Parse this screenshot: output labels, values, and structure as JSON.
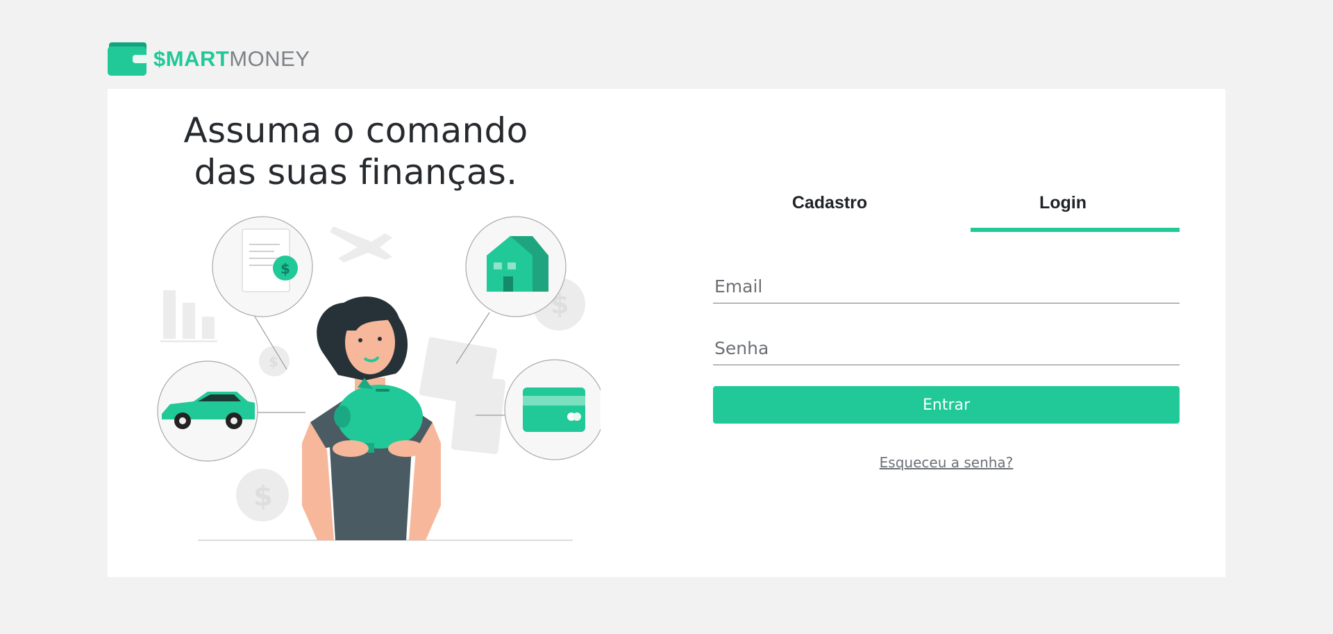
{
  "brand": {
    "name_bold": "$MART",
    "name_light": "MONEY",
    "accent_color": "#20c997",
    "icon": "wallet-icon"
  },
  "hero": {
    "headline": "Assuma o comando das suas finanças.",
    "illustration": "woman-holding-piggy-bank-illustration"
  },
  "auth": {
    "tabs": [
      {
        "label": "Cadastro",
        "active": false
      },
      {
        "label": "Login",
        "active": true
      }
    ],
    "email_placeholder": "Email",
    "password_placeholder": "Senha",
    "submit_label": "Entrar",
    "forgot_label": "Esqueceu a senha?"
  }
}
